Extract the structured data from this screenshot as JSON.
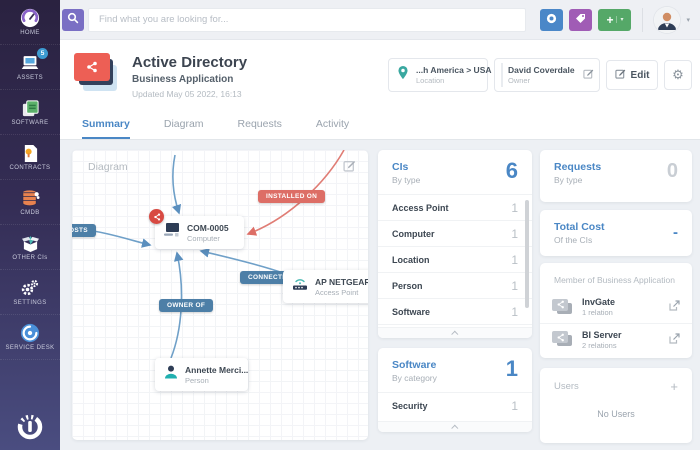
{
  "topbar": {
    "search_placeholder": "Find what you are looking for...",
    "add_plus": "+",
    "caret_down": "▾"
  },
  "sidebar": {
    "items": [
      {
        "label": "HOME",
        "icon": "gauge-icon"
      },
      {
        "label": "ASSETS",
        "icon": "laptop-icon",
        "badge": "5"
      },
      {
        "label": "SOFTWARE",
        "icon": "software-box-icon"
      },
      {
        "label": "CONTRACTS",
        "icon": "contract-document-icon"
      },
      {
        "label": "CMDB",
        "icon": "database-icon"
      },
      {
        "label": "OTHER CIs",
        "icon": "open-box-icon"
      },
      {
        "label": "SETTINGS",
        "icon": "gears-icon"
      },
      {
        "label": "SERVICE DESK",
        "icon": "service-desk-icon"
      }
    ]
  },
  "header": {
    "title": "Active Directory",
    "subtitle": "Business Application",
    "updated": "Updated May 05 2022, 16:13",
    "location": {
      "value": "...h America > USA",
      "label": "Location"
    },
    "owner": {
      "value": "David Coverdale",
      "label": "Owner"
    },
    "edit_label": "Edit",
    "gear": "⚙"
  },
  "tabs": [
    {
      "label": "Summary",
      "active": true
    },
    {
      "label": "Diagram",
      "active": false
    },
    {
      "label": "Requests",
      "active": false
    },
    {
      "label": "Activity",
      "active": false
    }
  ],
  "diagram": {
    "title": "Diagram",
    "nodes": [
      {
        "name": "COM-0005",
        "type": "Computer"
      },
      {
        "name": "AP NETGEAR",
        "type": "Access Point"
      },
      {
        "name": "Annette Merci...",
        "type": "Person"
      }
    ],
    "edges": [
      {
        "label": "HOSTS",
        "color": "#4d7fa7"
      },
      {
        "label": "INSTALLED ON",
        "color": "#dd6e66"
      },
      {
        "label": "CONNECTED TO",
        "color": "#4d7fa7"
      },
      {
        "label": "OWNER OF",
        "color": "#4d7fa7"
      }
    ]
  },
  "panels": {
    "cis": {
      "title": "CIs",
      "subtitle": "By type",
      "total": "6",
      "rows": [
        {
          "label": "Access Point",
          "value": "1"
        },
        {
          "label": "Computer",
          "value": "1"
        },
        {
          "label": "Location",
          "value": "1"
        },
        {
          "label": "Person",
          "value": "1"
        },
        {
          "label": "Software",
          "value": "1"
        }
      ]
    },
    "requests": {
      "title": "Requests",
      "subtitle": "By type",
      "total": "0"
    },
    "total_cost": {
      "title": "Total Cost",
      "subtitle": "Of the CIs",
      "total": "-"
    },
    "member": {
      "title": "Member of Business Application",
      "items": [
        {
          "name": "InvGate",
          "relations": "1 relation"
        },
        {
          "name": "BI Server",
          "relations": "2 relations"
        }
      ]
    },
    "software": {
      "title": "Software",
      "subtitle": "By category",
      "total": "1",
      "rows": [
        {
          "label": "Security",
          "value": "1"
        }
      ]
    },
    "users": {
      "title": "Users",
      "plus": "+",
      "empty": "No Users"
    }
  },
  "colors": {
    "accent_blue": "#4a87c5",
    "brand_red": "#ed5f55",
    "pill_blue": "#4d7fa7",
    "pill_red": "#dd6e66",
    "button_green": "#55a868",
    "button_purple": "#a05cb5",
    "button_blue": "#4a87c8",
    "search_purple": "#7a6fc4",
    "sidebar_top": "#2a2240",
    "sidebar_bottom": "#4a4d80"
  }
}
